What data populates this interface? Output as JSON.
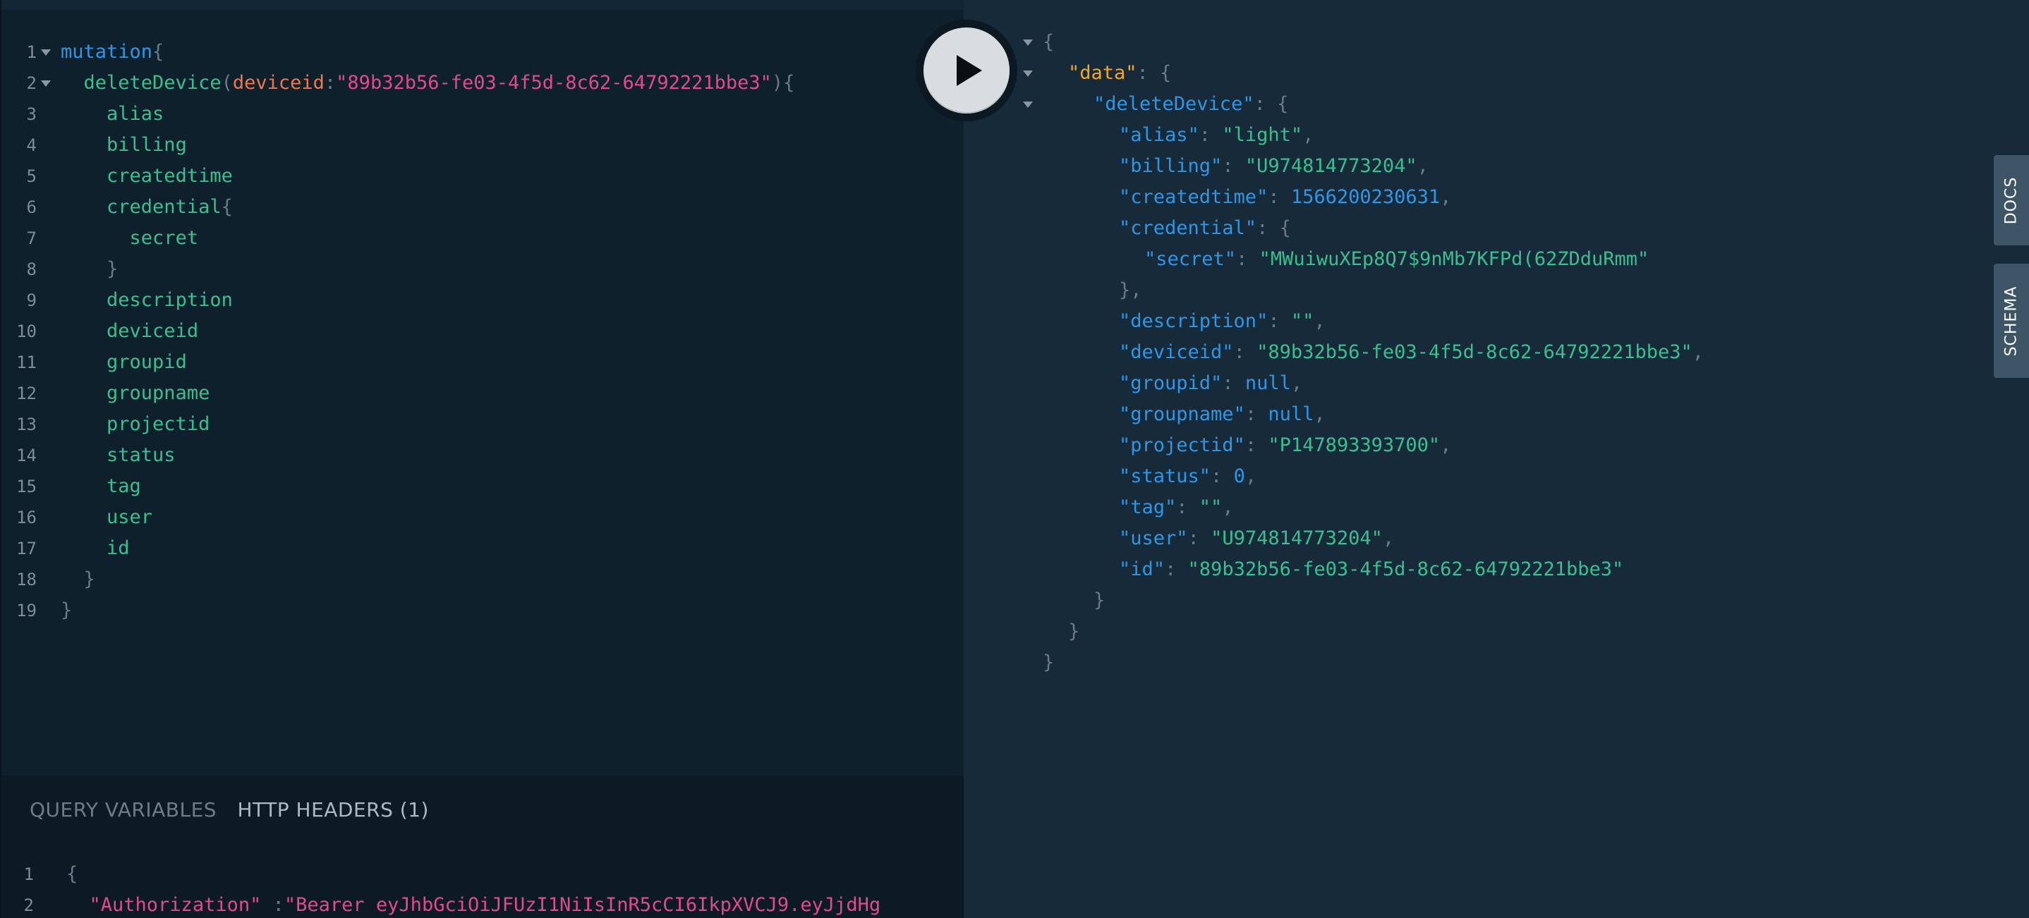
{
  "editor": {
    "lines": [
      {
        "n": "1",
        "fold": true,
        "indent": "",
        "segs": [
          {
            "c": "k",
            "t": "mutation"
          },
          {
            "c": "p",
            "t": "{"
          }
        ]
      },
      {
        "n": "2",
        "fold": true,
        "indent": "  ",
        "segs": [
          {
            "c": "f",
            "t": "deleteDevice"
          },
          {
            "c": "p",
            "t": "("
          },
          {
            "c": "a",
            "t": "deviceid"
          },
          {
            "c": "p",
            "t": ":"
          },
          {
            "c": "s",
            "t": "\"89b32b56-fe03-4f5d-8c62-64792221bbe3\""
          },
          {
            "c": "p",
            "t": "){"
          }
        ]
      },
      {
        "n": "3",
        "fold": false,
        "indent": "    ",
        "segs": [
          {
            "c": "f",
            "t": "alias"
          }
        ]
      },
      {
        "n": "4",
        "fold": false,
        "indent": "    ",
        "segs": [
          {
            "c": "f",
            "t": "billing"
          }
        ]
      },
      {
        "n": "5",
        "fold": false,
        "indent": "    ",
        "segs": [
          {
            "c": "f",
            "t": "createdtime"
          }
        ]
      },
      {
        "n": "6",
        "fold": false,
        "indent": "    ",
        "segs": [
          {
            "c": "f",
            "t": "credential"
          },
          {
            "c": "p",
            "t": "{"
          }
        ]
      },
      {
        "n": "7",
        "fold": false,
        "indent": "      ",
        "segs": [
          {
            "c": "f",
            "t": "secret"
          }
        ]
      },
      {
        "n": "8",
        "fold": false,
        "indent": "    ",
        "segs": [
          {
            "c": "p",
            "t": "}"
          }
        ]
      },
      {
        "n": "9",
        "fold": false,
        "indent": "    ",
        "segs": [
          {
            "c": "f",
            "t": "description"
          }
        ]
      },
      {
        "n": "10",
        "fold": false,
        "indent": "    ",
        "segs": [
          {
            "c": "f",
            "t": "deviceid"
          }
        ]
      },
      {
        "n": "11",
        "fold": false,
        "indent": "    ",
        "segs": [
          {
            "c": "f",
            "t": "groupid"
          }
        ]
      },
      {
        "n": "12",
        "fold": false,
        "indent": "    ",
        "segs": [
          {
            "c": "f",
            "t": "groupname"
          }
        ]
      },
      {
        "n": "13",
        "fold": false,
        "indent": "    ",
        "segs": [
          {
            "c": "f",
            "t": "projectid"
          }
        ]
      },
      {
        "n": "14",
        "fold": false,
        "indent": "    ",
        "segs": [
          {
            "c": "f",
            "t": "status"
          }
        ]
      },
      {
        "n": "15",
        "fold": false,
        "indent": "    ",
        "segs": [
          {
            "c": "f",
            "t": "tag"
          }
        ]
      },
      {
        "n": "16",
        "fold": false,
        "indent": "    ",
        "segs": [
          {
            "c": "f",
            "t": "user"
          }
        ]
      },
      {
        "n": "17",
        "fold": false,
        "indent": "    ",
        "segs": [
          {
            "c": "f",
            "t": "id"
          }
        ]
      },
      {
        "n": "18",
        "fold": false,
        "indent": "  ",
        "segs": [
          {
            "c": "p",
            "t": "}"
          }
        ]
      },
      {
        "n": "19",
        "fold": false,
        "indent": "",
        "segs": [
          {
            "c": "p",
            "t": "}"
          }
        ]
      }
    ]
  },
  "variables": {
    "tab_query_variables": "QUERY VARIABLES",
    "tab_http_headers": "HTTP HEADERS (1)",
    "lines": [
      {
        "n": "1",
        "indent": "",
        "segs": [
          {
            "c": "p",
            "t": "{"
          }
        ]
      },
      {
        "n": "2",
        "indent": "  ",
        "segs": [
          {
            "c": "s",
            "t": "\"Authorization\""
          },
          {
            "c": "p",
            "t": " :"
          },
          {
            "c": "s",
            "t": "\"Bearer eyJhbGciOiJFUzI1NiIsInR5cCI6IkpXVCJ9.eyJjdHg"
          }
        ]
      }
    ]
  },
  "result": {
    "lines": [
      {
        "fold": true,
        "indent": 0,
        "segs": [
          {
            "c": "rp",
            "t": "{"
          }
        ]
      },
      {
        "fold": true,
        "indent": 1,
        "segs": [
          {
            "c": "rdata",
            "t": "\"data\""
          },
          {
            "c": "rp",
            "t": ": {"
          }
        ]
      },
      {
        "fold": true,
        "indent": 2,
        "segs": [
          {
            "c": "rk",
            "t": "\"deleteDevice\""
          },
          {
            "c": "rp",
            "t": ": {"
          }
        ]
      },
      {
        "fold": false,
        "indent": 3,
        "segs": [
          {
            "c": "rk",
            "t": "\"alias\""
          },
          {
            "c": "rp",
            "t": ": "
          },
          {
            "c": "rs",
            "t": "\"light\""
          },
          {
            "c": "rp",
            "t": ","
          }
        ]
      },
      {
        "fold": false,
        "indent": 3,
        "segs": [
          {
            "c": "rk",
            "t": "\"billing\""
          },
          {
            "c": "rp",
            "t": ": "
          },
          {
            "c": "rs",
            "t": "\"U974814773204\""
          },
          {
            "c": "rp",
            "t": ","
          }
        ]
      },
      {
        "fold": false,
        "indent": 3,
        "segs": [
          {
            "c": "rk",
            "t": "\"createdtime\""
          },
          {
            "c": "rp",
            "t": ": "
          },
          {
            "c": "rn",
            "t": "1566200230631"
          },
          {
            "c": "rp",
            "t": ","
          }
        ]
      },
      {
        "fold": false,
        "indent": 3,
        "segs": [
          {
            "c": "rk",
            "t": "\"credential\""
          },
          {
            "c": "rp",
            "t": ": {"
          }
        ]
      },
      {
        "fold": false,
        "indent": 4,
        "segs": [
          {
            "c": "rk",
            "t": "\"secret\""
          },
          {
            "c": "rp",
            "t": ": "
          },
          {
            "c": "rs",
            "t": "\"MWuiwuXEp8Q7$9nMb7KFPd(62ZDduRmm\""
          }
        ]
      },
      {
        "fold": false,
        "indent": 3,
        "segs": [
          {
            "c": "rp",
            "t": "},"
          }
        ]
      },
      {
        "fold": false,
        "indent": 3,
        "segs": [
          {
            "c": "rk",
            "t": "\"description\""
          },
          {
            "c": "rp",
            "t": ": "
          },
          {
            "c": "rs",
            "t": "\"\""
          },
          {
            "c": "rp",
            "t": ","
          }
        ]
      },
      {
        "fold": false,
        "indent": 3,
        "segs": [
          {
            "c": "rk",
            "t": "\"deviceid\""
          },
          {
            "c": "rp",
            "t": ": "
          },
          {
            "c": "rs",
            "t": "\"89b32b56-fe03-4f5d-8c62-64792221bbe3\""
          },
          {
            "c": "rp",
            "t": ","
          }
        ]
      },
      {
        "fold": false,
        "indent": 3,
        "segs": [
          {
            "c": "rk",
            "t": "\"groupid\""
          },
          {
            "c": "rp",
            "t": ": "
          },
          {
            "c": "rn",
            "t": "null"
          },
          {
            "c": "rp",
            "t": ","
          }
        ]
      },
      {
        "fold": false,
        "indent": 3,
        "segs": [
          {
            "c": "rk",
            "t": "\"groupname\""
          },
          {
            "c": "rp",
            "t": ": "
          },
          {
            "c": "rn",
            "t": "null"
          },
          {
            "c": "rp",
            "t": ","
          }
        ]
      },
      {
        "fold": false,
        "indent": 3,
        "segs": [
          {
            "c": "rk",
            "t": "\"projectid\""
          },
          {
            "c": "rp",
            "t": ": "
          },
          {
            "c": "rs",
            "t": "\"P147893393700\""
          },
          {
            "c": "rp",
            "t": ","
          }
        ]
      },
      {
        "fold": false,
        "indent": 3,
        "segs": [
          {
            "c": "rk",
            "t": "\"status\""
          },
          {
            "c": "rp",
            "t": ": "
          },
          {
            "c": "rn",
            "t": "0"
          },
          {
            "c": "rp",
            "t": ","
          }
        ]
      },
      {
        "fold": false,
        "indent": 3,
        "segs": [
          {
            "c": "rk",
            "t": "\"tag\""
          },
          {
            "c": "rp",
            "t": ": "
          },
          {
            "c": "rs",
            "t": "\"\""
          },
          {
            "c": "rp",
            "t": ","
          }
        ]
      },
      {
        "fold": false,
        "indent": 3,
        "segs": [
          {
            "c": "rk",
            "t": "\"user\""
          },
          {
            "c": "rp",
            "t": ": "
          },
          {
            "c": "rs",
            "t": "\"U974814773204\""
          },
          {
            "c": "rp",
            "t": ","
          }
        ]
      },
      {
        "fold": false,
        "indent": 3,
        "segs": [
          {
            "c": "rk",
            "t": "\"id\""
          },
          {
            "c": "rp",
            "t": ": "
          },
          {
            "c": "rs",
            "t": "\"89b32b56-fe03-4f5d-8c62-64792221bbe3\""
          }
        ]
      },
      {
        "fold": false,
        "indent": 2,
        "segs": [
          {
            "c": "rp",
            "t": "}"
          }
        ]
      },
      {
        "fold": false,
        "indent": 1,
        "segs": [
          {
            "c": "rp",
            "t": "}"
          }
        ]
      },
      {
        "fold": false,
        "indent": 0,
        "segs": [
          {
            "c": "rp",
            "t": "}"
          }
        ]
      }
    ]
  },
  "sidebar_tabs": {
    "docs": "DOCS",
    "schema": "SCHEMA"
  },
  "run_button": {
    "icon": "play-icon"
  },
  "colors": {
    "editor_bg": "#0f202d",
    "result_bg": "#172a3a",
    "keyword": "#2f96e6",
    "field": "#3bbf8e",
    "argument": "#f0764b",
    "string_arg": "#e24a8b",
    "data_key": "#f5a623"
  }
}
